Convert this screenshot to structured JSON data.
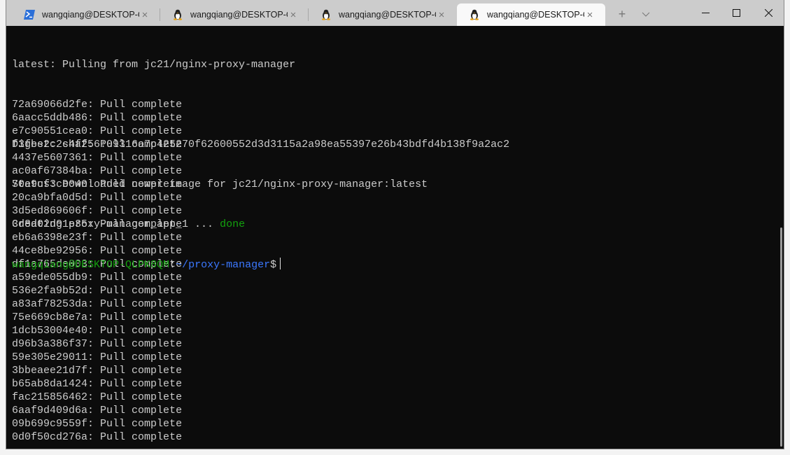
{
  "tabs": [
    {
      "title": "wangqiang@DESKTOP-QL",
      "icon": "powershell-icon",
      "active": false
    },
    {
      "title": "wangqiang@DESKTOP-QL",
      "icon": "linux-penguin-icon",
      "active": false
    },
    {
      "title": "wangqiang@DESKTOP-QL",
      "icon": "linux-penguin-icon",
      "active": false
    },
    {
      "title": "wangqiang@DESKTOP-QL",
      "icon": "linux-penguin-icon",
      "active": true
    }
  ],
  "tab_close": "×",
  "new_tab": "+",
  "dropdown": "⌵",
  "window": {
    "minimize": "—",
    "maximize": "☐",
    "close": "✕"
  },
  "terminal": {
    "header": "latest: Pulling from jc21/nginx-proxy-manager",
    "layers": [
      {
        "id": "72a69066d2fe",
        "status": "Pull complete"
      },
      {
        "id": "6aacc5ddb486",
        "status": "Pull complete"
      },
      {
        "id": "e7c90551cea0",
        "status": "Pull complete"
      },
      {
        "id": "f3fbe2c2c4ff",
        "status": "Pull complete"
      },
      {
        "id": "4437e5607361",
        "status": "Pull complete"
      },
      {
        "id": "ac0af67384ba",
        "status": "Pull complete"
      },
      {
        "id": "70e9cf3ce040",
        "status": "Pull complete"
      },
      {
        "id": "20ca9bfa0d5d",
        "status": "Pull complete"
      },
      {
        "id": "3d5ed869606f",
        "status": "Pull complete"
      },
      {
        "id": "3d8d02d01e35",
        "status": "Pull complete"
      },
      {
        "id": "eb6a6398e23f",
        "status": "Pull complete"
      },
      {
        "id": "44ce8be92956",
        "status": "Pull complete"
      },
      {
        "id": "df1a765de003",
        "status": "Pull complete"
      },
      {
        "id": "a59ede055db9",
        "status": "Pull complete"
      },
      {
        "id": "536e2fa9b52d",
        "status": "Pull complete"
      },
      {
        "id": "a83af78253da",
        "status": "Pull complete"
      },
      {
        "id": "75e669cb8e7a",
        "status": "Pull complete"
      },
      {
        "id": "1dcb53004e40",
        "status": "Pull complete"
      },
      {
        "id": "d96b3a386f37",
        "status": "Pull complete"
      },
      {
        "id": "59e305e29011",
        "status": "Pull complete"
      },
      {
        "id": "3bbeaee21d7f",
        "status": "Pull complete"
      },
      {
        "id": "b65ab8da1424",
        "status": "Pull complete"
      },
      {
        "id": "fac215856462",
        "status": "Pull complete"
      },
      {
        "id": "6aaf9d409d6a",
        "status": "Pull complete"
      },
      {
        "id": "09b699c9559f",
        "status": "Pull complete"
      },
      {
        "id": "0d0f50cd276a",
        "status": "Pull complete"
      }
    ],
    "digest": "Digest: sha256:09316a7c425270f62600552d3d3115a2a98ea55397e26b43bdfd4b138f9a2ac2",
    "status": "Status: Downloaded newer image for jc21/nginx-proxy-manager:latest",
    "creating": "Creating proxy-manager_app_1 ... ",
    "creating_result": "done",
    "prompt_user": "wangqiang@DESKTOP-QLPK8QM",
    "prompt_sep": ":",
    "prompt_path": "~/proxy-manager",
    "prompt_symbol": "$"
  },
  "colors": {
    "background": "#0c0c0c",
    "text": "#cccccc",
    "green": "#13a10e",
    "blue": "#3b78ff"
  }
}
